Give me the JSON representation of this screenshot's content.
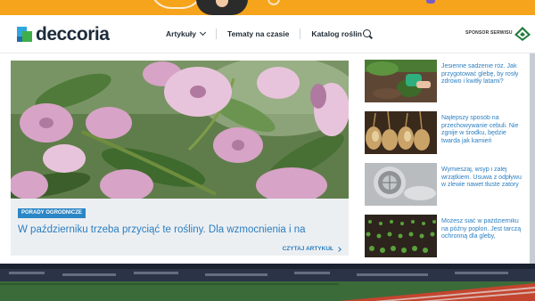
{
  "brand": {
    "name": "deccoria",
    "colors": {
      "accent": "#2b7ec0",
      "badge": "#2b86c5",
      "banner": "#f5a41c"
    }
  },
  "header": {
    "nav": [
      {
        "label": "Artykuły",
        "has_dropdown": true
      },
      {
        "label": "Tematy na czasie"
      },
      {
        "label": "Katalog roślin"
      }
    ],
    "search_icon": "search-icon",
    "sponsor_label": "SPONSOR SERWISU"
  },
  "hero": {
    "badge": "PORADY OGRODNICZE",
    "title": "W październiku trzeba przyciąć te rośliny. Dla wzmocnienia i na",
    "read_more": "CZYTAJ ARTYKUŁ"
  },
  "side_articles": [
    {
      "title": "Jesienne sadzenie róż. Jak przygotować glebę, by rosły zdrowo i kwitły latami?"
    },
    {
      "title": "Najlepszy sposób na przechowywanie cebuli. Nie zgnije w środku, będzie twarda jak kamień"
    },
    {
      "title": "Wymieszaj, wsyp i zalej wrzątkiem. Usuwa z odpływu w zlewie nawet tłuste zatory"
    },
    {
      "title": "Możesz siać w październiku na późny poplon. Jest tarczą ochronną dla gleby,"
    }
  ]
}
